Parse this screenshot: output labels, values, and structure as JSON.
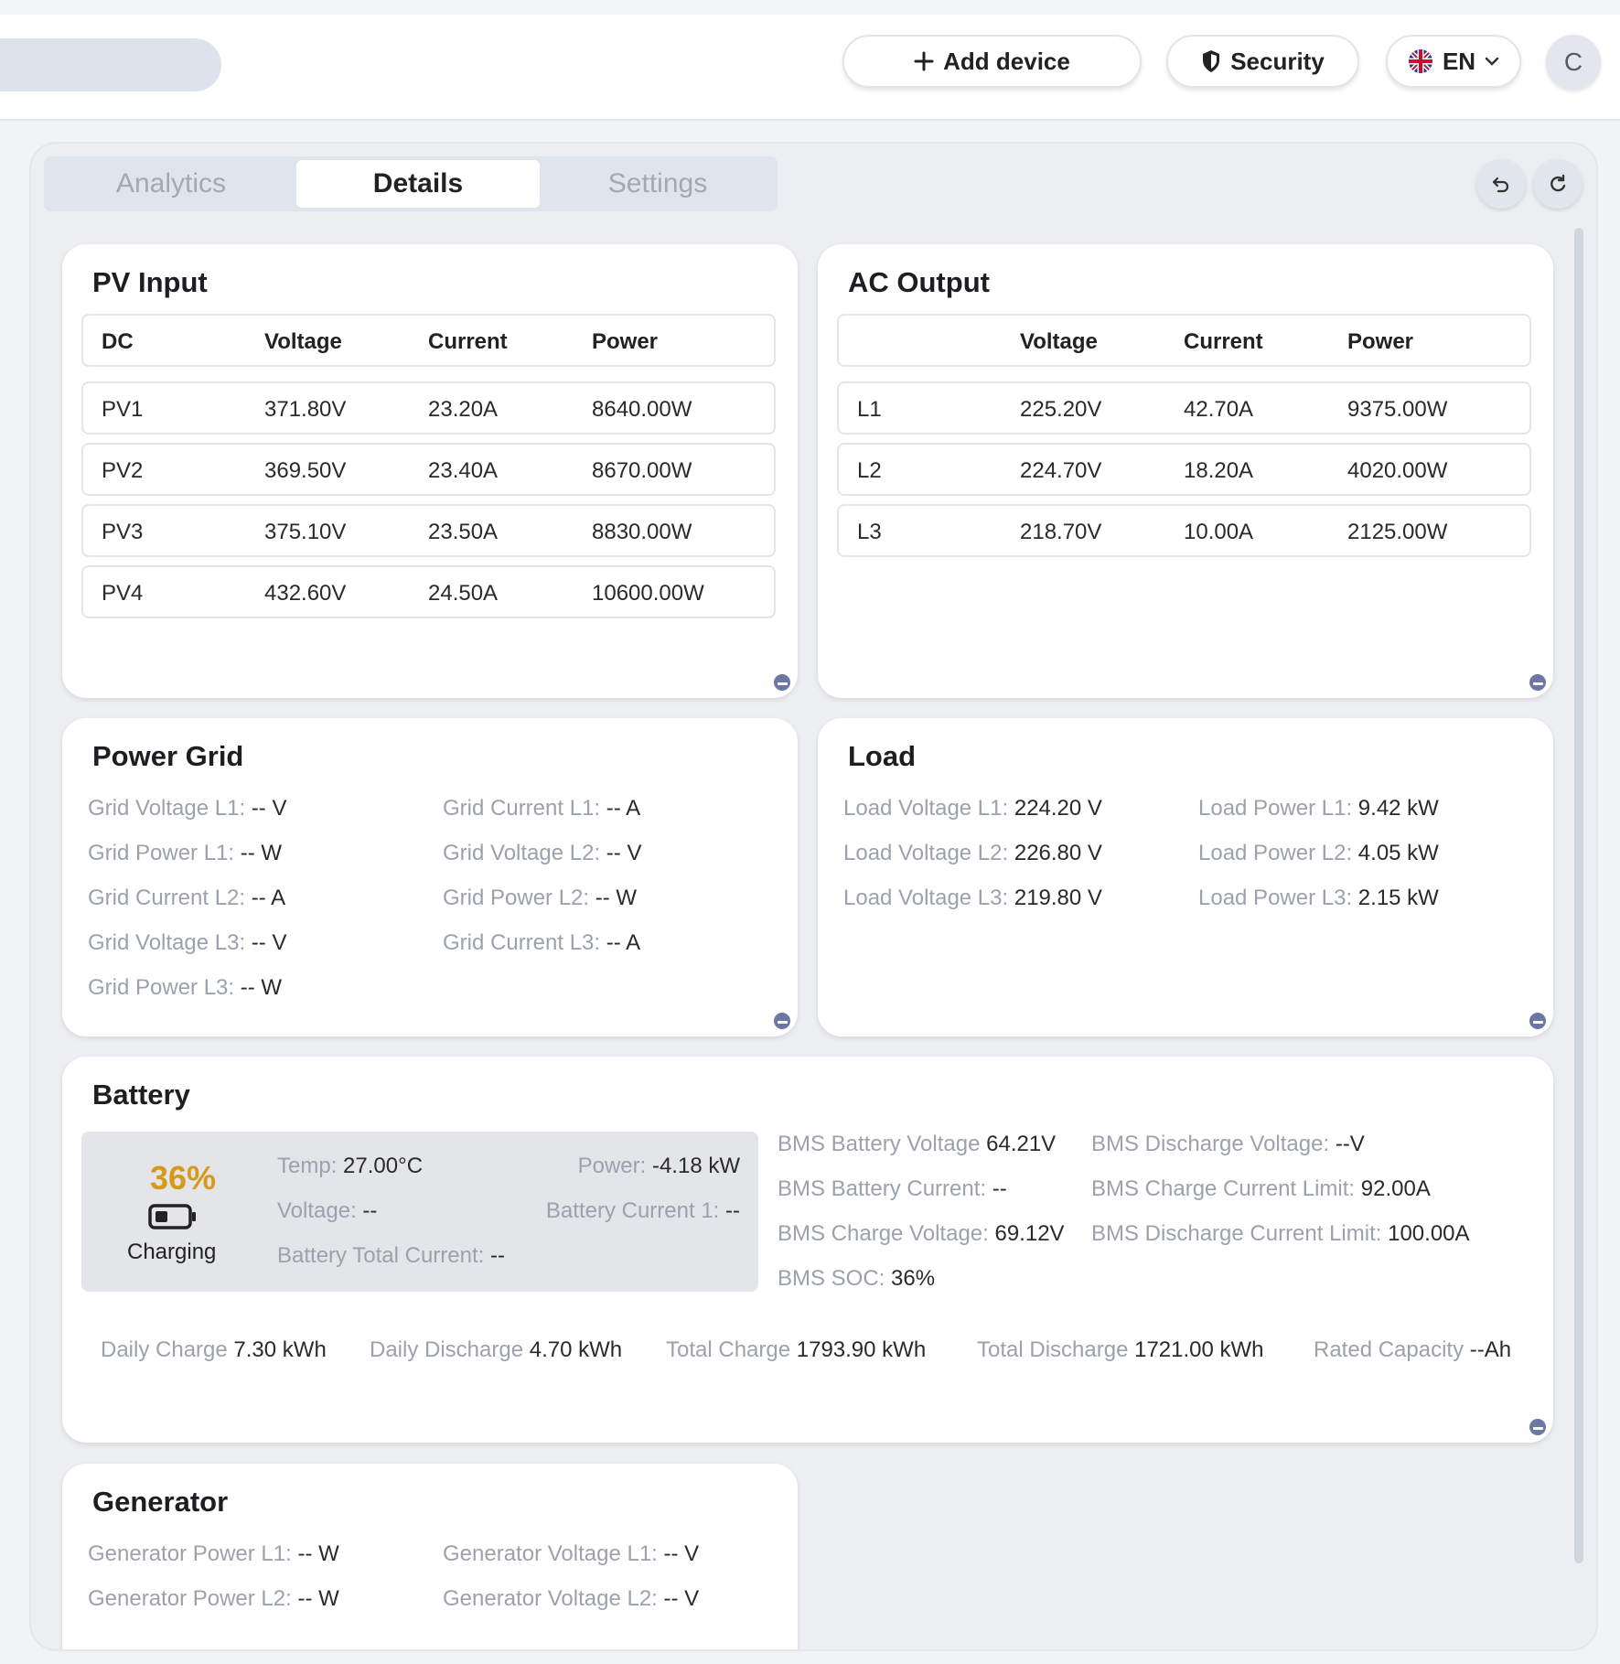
{
  "header": {
    "add_device": "Add device",
    "security": "Security",
    "language": "EN",
    "avatar_initial": "C"
  },
  "tabs": [
    "Analytics",
    "Details",
    "Settings"
  ],
  "pv_input": {
    "title": "PV Input",
    "headers": [
      "DC",
      "Voltage",
      "Current",
      "Power"
    ],
    "rows": [
      [
        "PV1",
        "371.80V",
        "23.20A",
        "8640.00W"
      ],
      [
        "PV2",
        "369.50V",
        "23.40A",
        "8670.00W"
      ],
      [
        "PV3",
        "375.10V",
        "23.50A",
        "8830.00W"
      ],
      [
        "PV4",
        "432.60V",
        "24.50A",
        "10600.00W"
      ]
    ]
  },
  "ac_output": {
    "title": "AC Output",
    "headers": [
      "",
      "Voltage",
      "Current",
      "Power"
    ],
    "rows": [
      [
        "L1",
        "225.20V",
        "42.70A",
        "9375.00W"
      ],
      [
        "L2",
        "224.70V",
        "18.20A",
        "4020.00W"
      ],
      [
        "L3",
        "218.70V",
        "10.00A",
        "2125.00W"
      ]
    ]
  },
  "power_grid": {
    "title": "Power Grid",
    "items": [
      {
        "label": "Grid Voltage L1:",
        "value": "-- V"
      },
      {
        "label": "Grid Current L1:",
        "value": "-- A"
      },
      {
        "label": "Grid Power L1:",
        "value": "-- W"
      },
      {
        "label": "Grid Voltage L2:",
        "value": "-- V"
      },
      {
        "label": "Grid Current L2:",
        "value": "-- A"
      },
      {
        "label": "Grid Power L2:",
        "value": "-- W"
      },
      {
        "label": "Grid Voltage L3:",
        "value": "-- V"
      },
      {
        "label": "Grid Current L3:",
        "value": "-- A"
      },
      {
        "label": "Grid Power L3:",
        "value": "-- W"
      }
    ]
  },
  "load": {
    "title": "Load",
    "items": [
      {
        "label": "Load Voltage L1:",
        "value": "224.20 V"
      },
      {
        "label": "Load Power L1:",
        "value": "9.42 kW"
      },
      {
        "label": "Load Voltage L2:",
        "value": "226.80 V"
      },
      {
        "label": "Load Power L2:",
        "value": "4.05 kW"
      },
      {
        "label": "Load Voltage L3:",
        "value": "219.80 V"
      },
      {
        "label": "Load Power L3:",
        "value": "2.15 kW"
      }
    ]
  },
  "battery": {
    "title": "Battery",
    "soc": "36%",
    "status": "Charging",
    "temp": {
      "label": "Temp:",
      "value": "27.00°C"
    },
    "power": {
      "label": "Power:",
      "value": "-4.18 kW"
    },
    "voltage": {
      "label": "Voltage:",
      "value": "--"
    },
    "current1": {
      "label": "Battery Current 1:",
      "value": "--"
    },
    "total_current": {
      "label": "Battery Total Current:",
      "value": "--"
    },
    "bms": [
      {
        "label": "BMS Battery Voltage",
        "value": "64.21V"
      },
      {
        "label": "BMS Discharge Voltage:",
        "value": "--V"
      },
      {
        "label": "BMS Battery Current:",
        "value": "--"
      },
      {
        "label": "BMS Charge Current Limit:",
        "value": "92.00A"
      },
      {
        "label": "BMS Charge Voltage:",
        "value": "69.12V"
      },
      {
        "label": "BMS Discharge Current Limit:",
        "value": "100.00A"
      },
      {
        "label": "BMS SOC:",
        "value": "36%"
      }
    ],
    "stats": [
      {
        "label": "Daily Charge",
        "value": "7.30 kWh"
      },
      {
        "label": "Daily Discharge",
        "value": "4.70 kWh"
      },
      {
        "label": "Total Charge",
        "value": "1793.90 kWh"
      },
      {
        "label": "Total Discharge",
        "value": "1721.00 kWh"
      },
      {
        "label": "Rated Capacity",
        "value": "--Ah"
      }
    ]
  },
  "generator": {
    "title": "Generator",
    "items": [
      {
        "label": "Generator Power L1:",
        "value": "-- W"
      },
      {
        "label": "Generator Voltage L1:",
        "value": "-- V"
      },
      {
        "label": "Generator Power L2:",
        "value": "-- W"
      },
      {
        "label": "Generator Voltage L2:",
        "value": "-- V"
      }
    ]
  },
  "colors": {
    "accent_soc": "#d59a1b",
    "resize_handle": "#6d77a6",
    "tab_bg": "#dfe4ed"
  }
}
